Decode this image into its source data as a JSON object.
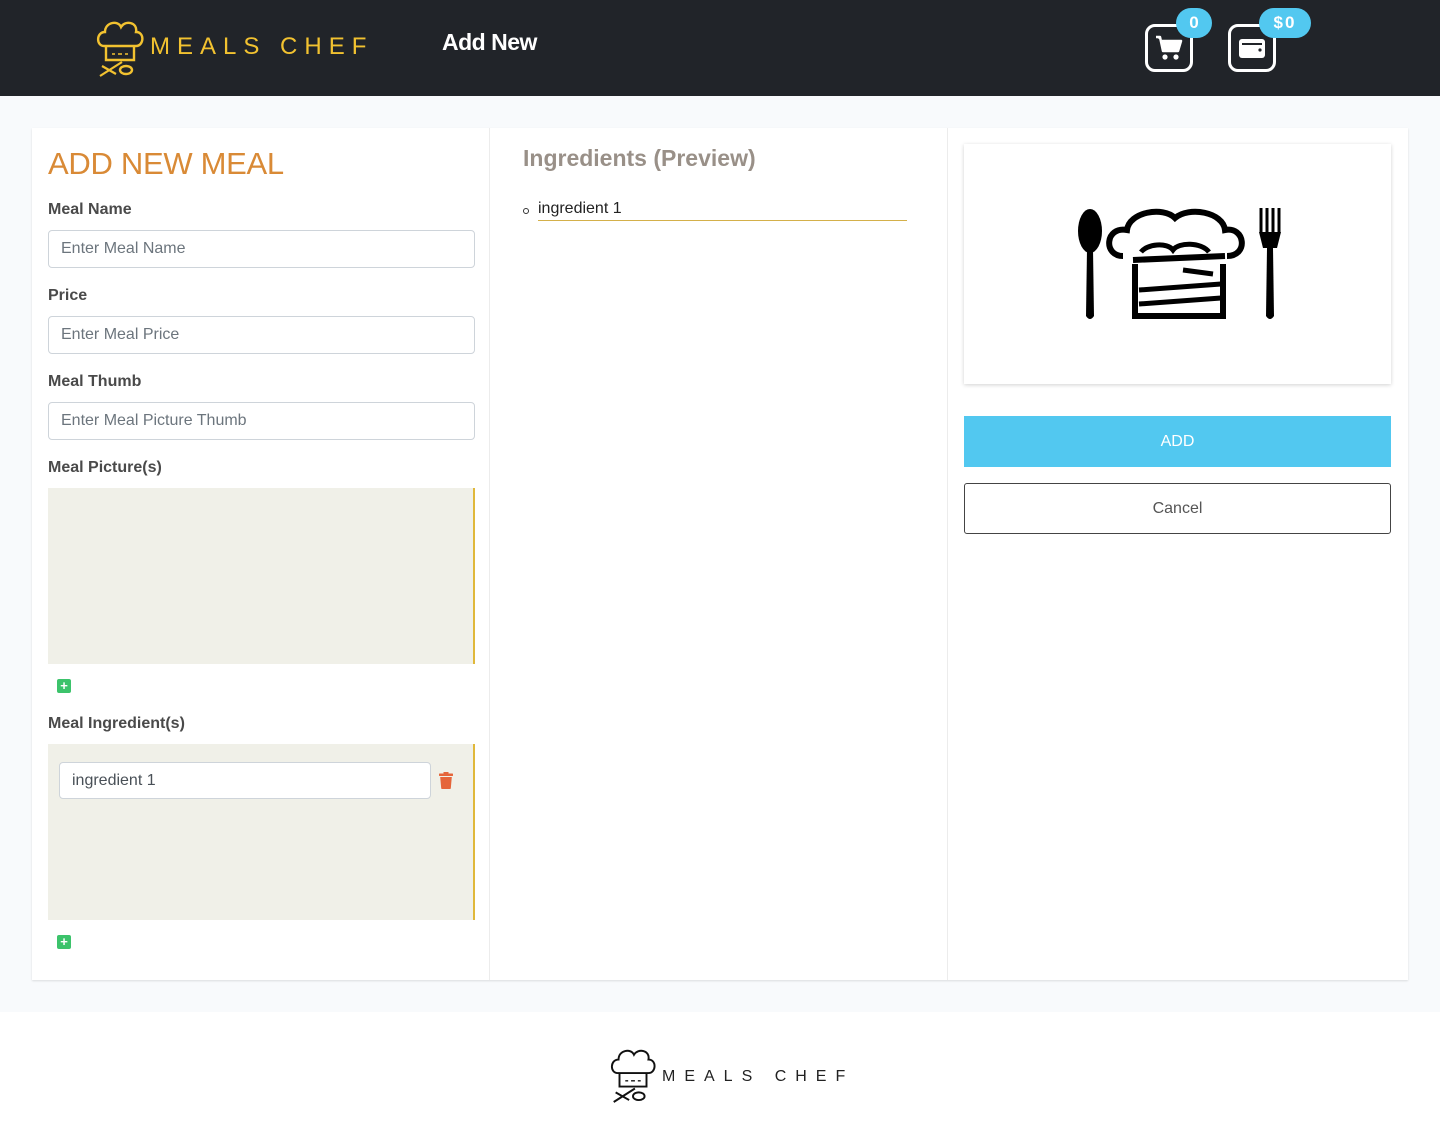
{
  "nav": {
    "brand": "MEALS CHEF",
    "link_add_new": "Add New",
    "cart_count": "0",
    "wallet_balance": "$0",
    "colors": {
      "background": "#212429",
      "brand": "#f2c230",
      "badge": "#52c8f0"
    }
  },
  "form": {
    "title": "ADD NEW MEAL",
    "meal_name": {
      "label": "Meal Name",
      "placeholder": "Enter Meal Name",
      "value": ""
    },
    "price": {
      "label": "Price",
      "placeholder": "Enter Meal Price",
      "value": ""
    },
    "thumb": {
      "label": "Meal Thumb",
      "placeholder": "Enter Meal Picture Thumb",
      "value": ""
    },
    "pictures": {
      "label": "Meal Picture(s)",
      "add_icon": "plus-square-icon"
    },
    "ingredients": {
      "label": "Meal Ingredient(s)",
      "items": [
        {
          "value": "ingredient 1",
          "delete_icon": "trash-icon"
        }
      ],
      "add_icon": "plus-square-icon"
    }
  },
  "preview": {
    "title": "Ingredients (Preview)",
    "items": [
      "ingredient 1"
    ]
  },
  "actions": {
    "image_icon": "chef-hat-cutlery-icon",
    "add_label": "ADD",
    "cancel_label": "Cancel"
  },
  "footer": {
    "brand": "MEALS CHEF"
  }
}
